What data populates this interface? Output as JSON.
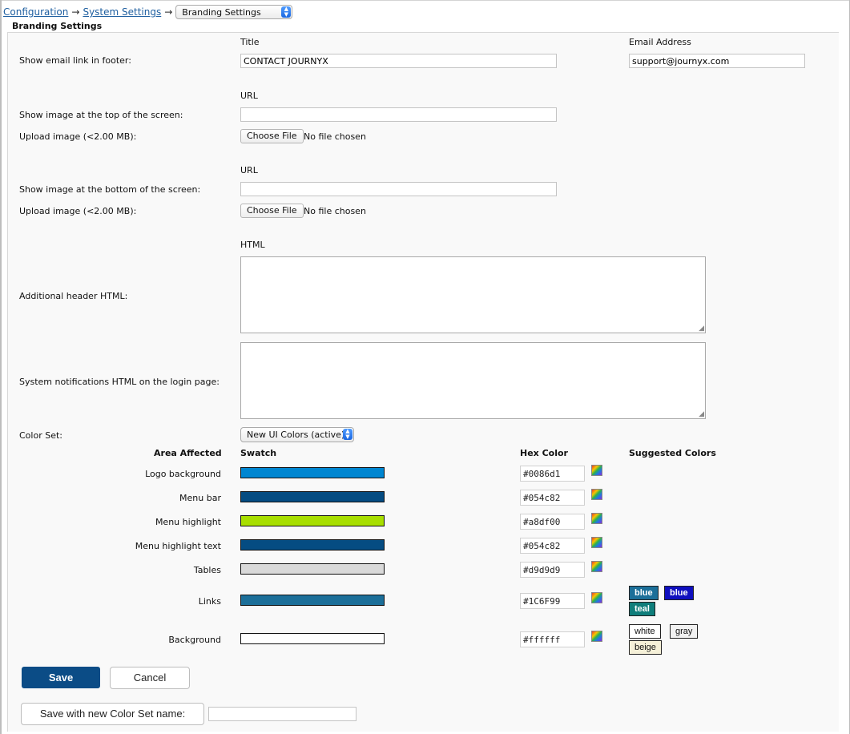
{
  "breadcrumb": {
    "items": [
      "Configuration",
      "System Settings"
    ],
    "separator": "→",
    "current_select": "Branding Settings"
  },
  "panel_title": "Branding Settings",
  "email_footer": {
    "label": "Show email link in footer:",
    "title_header": "Title",
    "title_value": "CONTACT JOURNYX",
    "email_header": "Email Address",
    "email_value": "support@journyx.com"
  },
  "top_image": {
    "url_header": "URL",
    "label": "Show image at the top of the screen:",
    "url_value": "",
    "upload_label": "Upload image (<2.00 MB):",
    "choose_button": "Choose File",
    "no_file": "No file chosen"
  },
  "bottom_image": {
    "url_header": "URL",
    "label": "Show image at the bottom of the screen:",
    "url_value": "",
    "upload_label": "Upload image (<2.00 MB):",
    "choose_button": "Choose File",
    "no_file": "No file chosen"
  },
  "header_html": {
    "col_header": "HTML",
    "label": "Additional header HTML:",
    "value": ""
  },
  "login_html": {
    "label": "System notifications HTML on the login page:",
    "value": ""
  },
  "color_set": {
    "label": "Color Set:",
    "selected": "New UI Colors (active)"
  },
  "color_table": {
    "headers": {
      "area": "Area Affected",
      "swatch": "Swatch",
      "hex": "Hex Color",
      "suggested": "Suggested Colors"
    },
    "rows": [
      {
        "area": "Logo background",
        "hex": "#0086d1",
        "color": "#0086d1"
      },
      {
        "area": "Menu bar",
        "hex": "#054c82",
        "color": "#054c82"
      },
      {
        "area": "Menu highlight",
        "hex": "#a8df00",
        "color": "#a8df00"
      },
      {
        "area": "Menu highlight text",
        "hex": "#054c82",
        "color": "#054c82"
      },
      {
        "area": "Tables",
        "hex": "#d9d9d9",
        "color": "#d9d9d9"
      },
      {
        "area": "Links",
        "hex": "#1C6F99",
        "color": "#1C6F99"
      },
      {
        "area": "Background",
        "hex": "#ffffff",
        "color": "#ffffff"
      }
    ],
    "link_suggestions": [
      {
        "label": "blue",
        "bg": "#1C6F99",
        "fg": "#ffffff"
      },
      {
        "label": "blue",
        "bg": "#0f0fbf",
        "fg": "#ffffff"
      },
      {
        "label": "teal",
        "bg": "#107e7b",
        "fg": "#ffffff"
      }
    ],
    "background_suggestions": [
      {
        "label": "white",
        "bg": "#ffffff",
        "fg": "#111111"
      },
      {
        "label": "gray",
        "bg": "#f2f2f2",
        "fg": "#111111"
      },
      {
        "label": "beige",
        "bg": "#f5f0d8",
        "fg": "#111111"
      }
    ]
  },
  "actions": {
    "save": "Save",
    "cancel": "Cancel",
    "save_new": "Save with new Color Set name:",
    "new_name_value": ""
  }
}
